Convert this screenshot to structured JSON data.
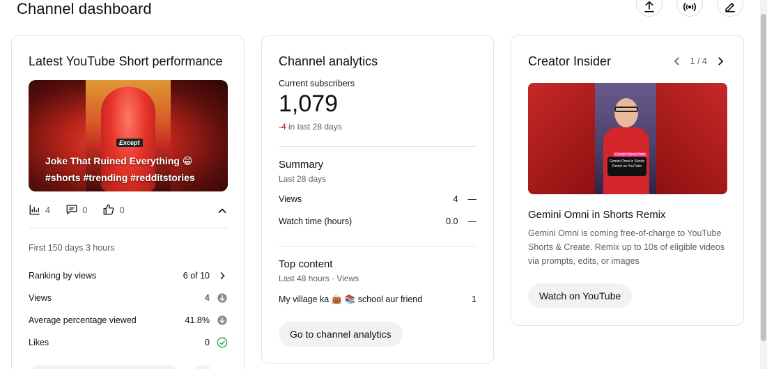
{
  "header": {
    "title": "Channel dashboard"
  },
  "short_card": {
    "title": "Latest YouTube Short performance",
    "thumbnail": {
      "tag": "Except",
      "caption": "Joke That Ruined Everything 😁 #shorts #trending #redditstories"
    },
    "stats": {
      "views": "4",
      "comments": "0",
      "likes": "0"
    },
    "period": "First 150 days 3 hours",
    "metrics": [
      {
        "label": "Ranking by views",
        "value": "6 of 10"
      },
      {
        "label": "Views",
        "value": "4"
      },
      {
        "label": "Average percentage viewed",
        "value": "41.8%"
      },
      {
        "label": "Likes",
        "value": "0"
      }
    ]
  },
  "analytics_card": {
    "title": "Channel analytics",
    "subscribers_label": "Current subscribers",
    "subscribers": "1,079",
    "delta_value": "-4",
    "delta_text": "in last 28 days",
    "summary_title": "Summary",
    "summary_period": "Last 28 days",
    "summary_rows": [
      {
        "label": "Views",
        "value": "4",
        "trend": "—"
      },
      {
        "label": "Watch time (hours)",
        "value": "0.0",
        "trend": "—"
      }
    ],
    "top_title": "Top content",
    "top_period": "Last 48 hours · Views",
    "top_rows": [
      {
        "label": "My village ka 👜 📚 school aur friend",
        "value": "1"
      }
    ],
    "button": "Go to channel analytics"
  },
  "insider_card": {
    "title": "Creator Insider",
    "pager": "1 / 4",
    "thumbnail": {
      "tag": "Creator NewsFlash",
      "screen_text": "Gemini Omni in Shorts Remix on YouTube"
    },
    "video_title": "Gemini Omni in Shorts Remix",
    "description": "Gemini Omni is coming free-of-charge to YouTube Shorts & Create. Remix up to 10s of eligible videos via prompts, edits, or images",
    "button": "Watch on YouTube"
  },
  "colors": {
    "negative": "#cc0000",
    "success": "#2e9e3e",
    "muted": "#606060"
  }
}
